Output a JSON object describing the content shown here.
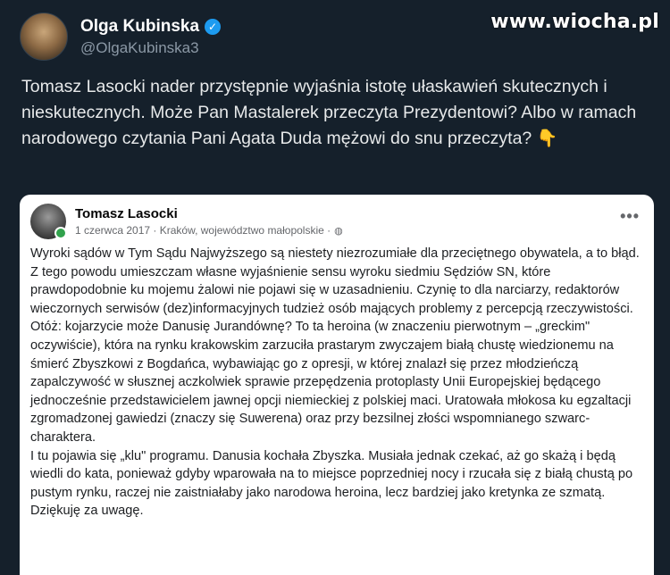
{
  "header": {
    "author_name": "Olga Kubinska",
    "handle": "@OlgaKubinska3",
    "watermark": "www.wiocha.pl"
  },
  "tweet": {
    "text": "Tomasz Lasocki nader przystępnie wyjaśnia istotę ułaskawień skutecznych i nieskutecznych. Może Pan Mastalerek przeczyta Prezydentowi? Albo w ramach narodowego czytania Pani Agata Duda mężowi do snu przeczyta?",
    "emoji": "👇"
  },
  "quote": {
    "author_name": "Tomasz Lasocki",
    "date": "1 czerwca 2017",
    "location": "Kraków, województwo małopolskie",
    "paragraphs": [
      "Wyroki sądów w Tym Sądu Najwyższego są niestety niezrozumiałe dla przeciętnego obywatela, a to błąd. Z tego powodu umieszczam własne wyjaśnienie sensu wyroku siedmiu Sędziów SN, które prawdopodobnie ku mojemu żalowi nie pojawi się w uzasadnieniu. Czynię to dla narciarzy, redaktorów wieczornych serwisów (dez)informacyjnych tudzież osób mających problemy z percepcją rzeczywistości.",
      "Otóż: kojarzycie może Danusię Jurandównę? To ta heroina (w znaczeniu pierwotnym – „greckim\" oczywiście), która na rynku krakowskim zarzuciła prastarym zwyczajem białą chustę wiedzionemu na śmierć Zbyszkowi z Bogdańca, wybawiając go z opresji, w której znalazł się przez młodzieńczą zapalczywość w słusznej aczkolwiek sprawie przepędzenia protoplasty Unii Europejskiej będącego jednocześnie przedstawicielem jawnej opcji niemieckiej z polskiej maci. Uratowała młokosa ku egzaltacji zgromadzonej gawiedzi (znaczy się Suwerena) oraz przy bezsilnej złości wspomnianego szwarc-charaktera.",
      "I tu pojawia się „klu\" programu. Danusia kochała Zbyszka. Musiała jednak czekać, aż go skażą i będą wiedli do kata, ponieważ gdyby wparowała na to miejsce poprzedniej nocy i rzucała się z białą chustą po pustym rynku, raczej nie zaistniałaby jako narodowa heroina, lecz bardziej jako kretynka ze szmatą.",
      "Dziękuję za uwagę."
    ]
  }
}
